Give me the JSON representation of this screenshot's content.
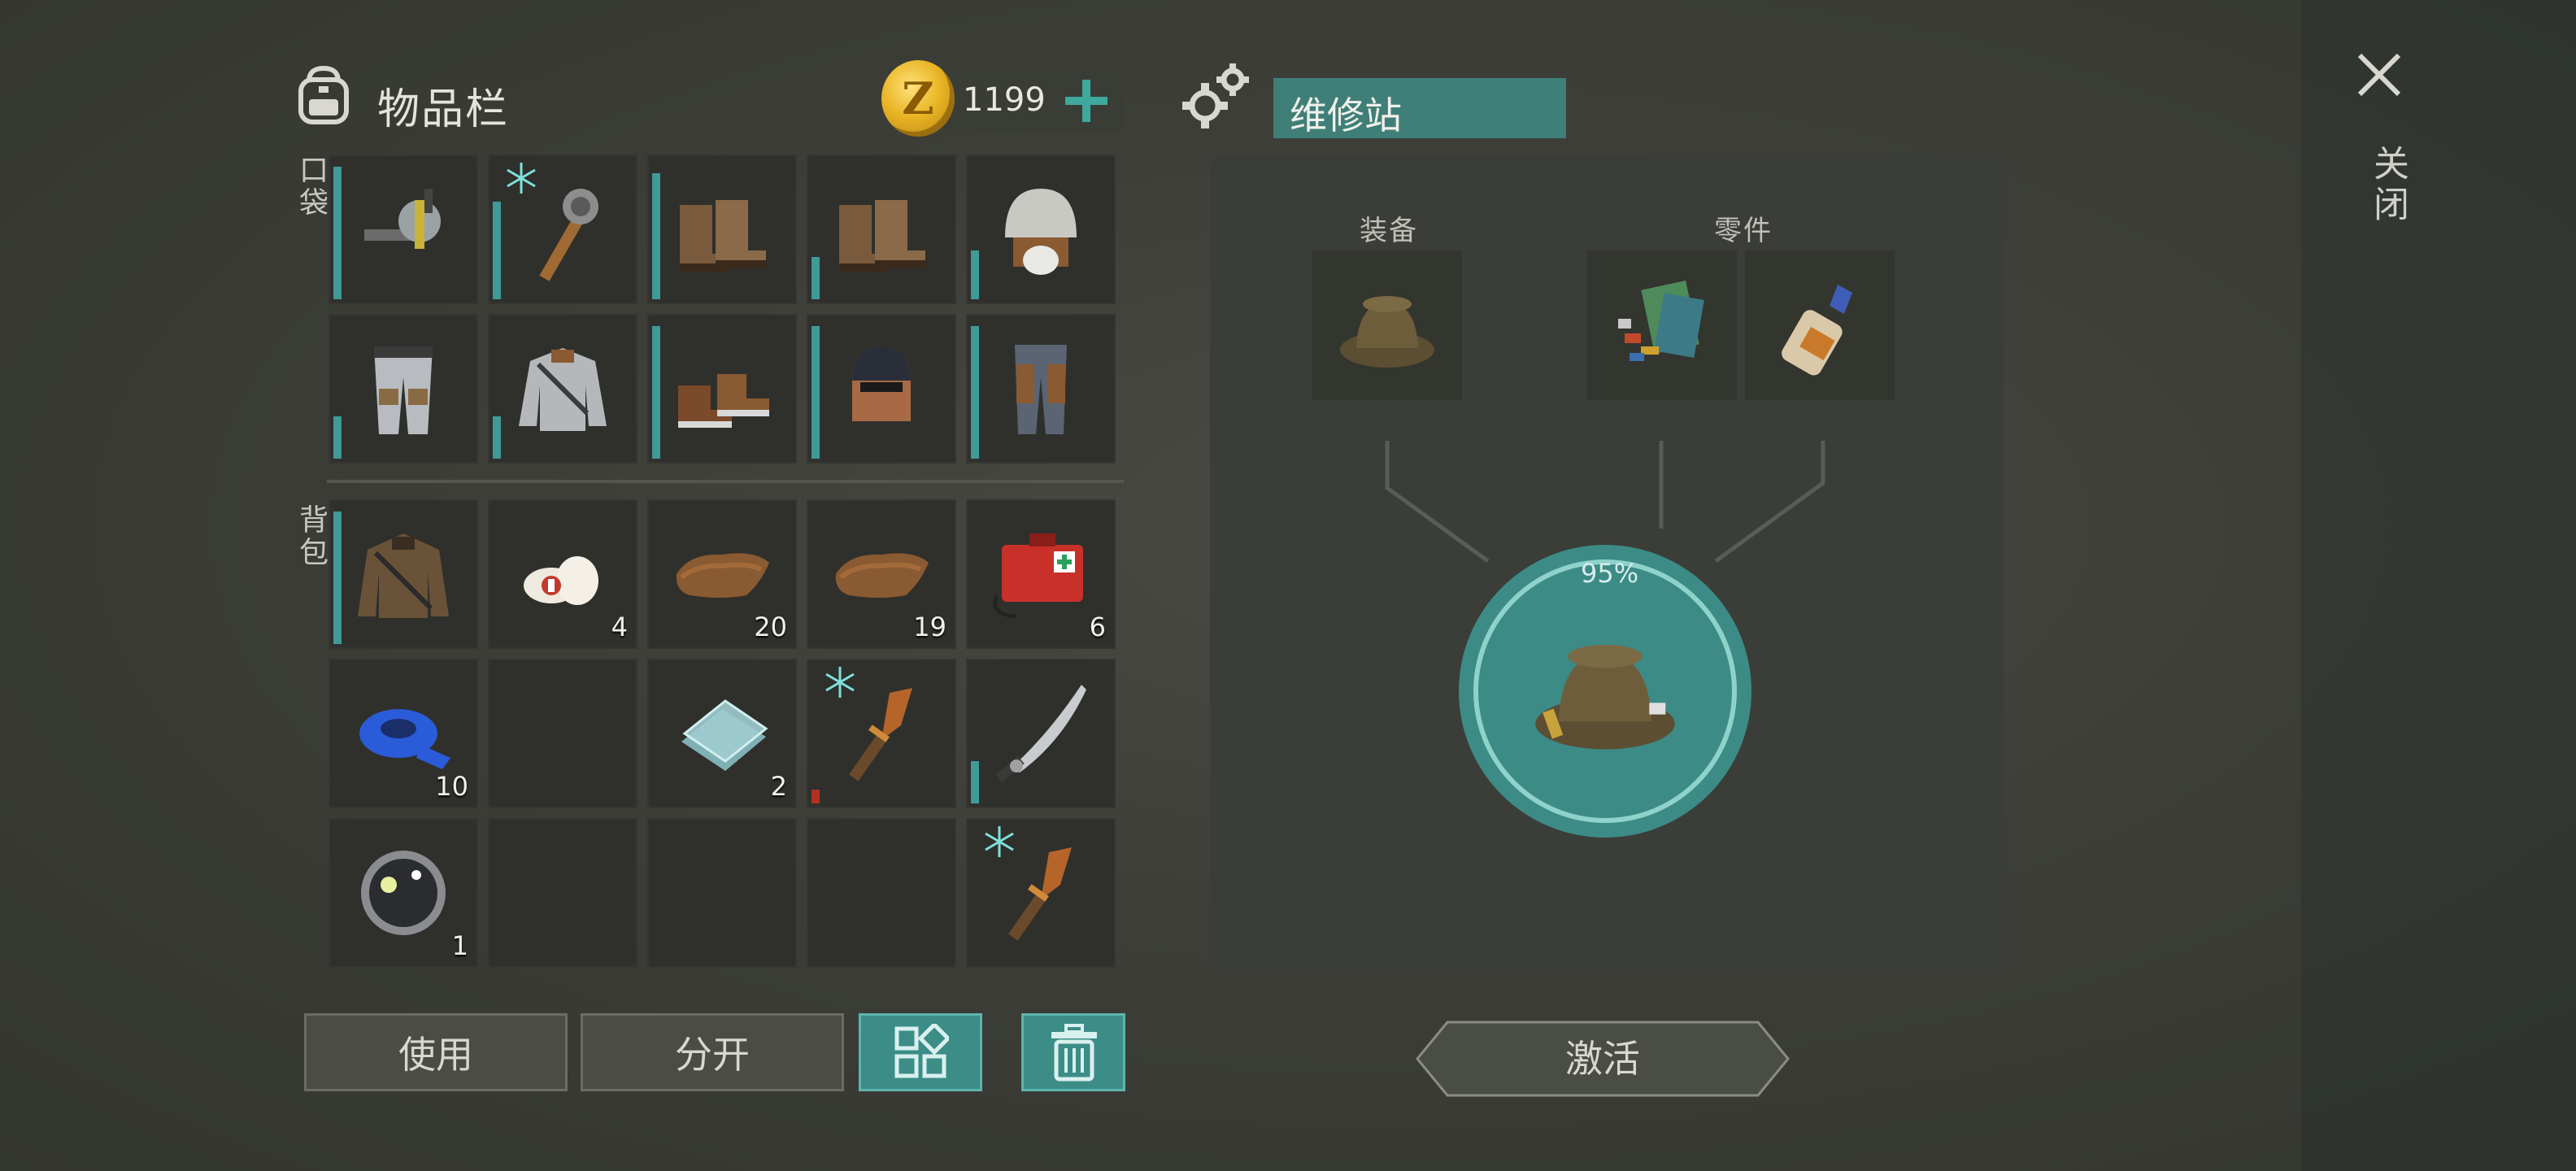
{
  "inventory": {
    "title": "物品栏",
    "coins": "1199"
  },
  "labels": {
    "pockets": "口袋",
    "backpack": "背包"
  },
  "pockets": [
    {
      "icon": "drill-icon",
      "count": "",
      "durability": 0.95,
      "frozen": false
    },
    {
      "icon": "spiked-club-icon",
      "count": "",
      "durability": 0.7,
      "frozen": true
    },
    {
      "icon": "boots-icon",
      "count": "",
      "durability": 0.9,
      "frozen": false
    },
    {
      "icon": "boots-icon",
      "count": "",
      "durability": 0.3,
      "frozen": false
    },
    {
      "icon": "fur-hat-icon",
      "count": "",
      "durability": 0.35,
      "frozen": false
    },
    {
      "icon": "armored-pants-icon",
      "count": "",
      "durability": 0.3,
      "frozen": false
    },
    {
      "icon": "armored-jacket-icon",
      "count": "",
      "durability": 0.3,
      "frozen": false
    },
    {
      "icon": "leather-shoes-icon",
      "count": "",
      "durability": 0.95,
      "frozen": false
    },
    {
      "icon": "welding-helmet-icon",
      "count": "",
      "durability": 0.95,
      "frozen": false
    },
    {
      "icon": "leather-pants-icon",
      "count": "",
      "durability": 0.95,
      "frozen": false
    }
  ],
  "backpack": [
    {
      "icon": "leather-jacket-icon",
      "count": "",
      "durability": 0.95,
      "frozen": false
    },
    {
      "icon": "bandage-icon",
      "count": "4",
      "durability": null,
      "frozen": false
    },
    {
      "icon": "leather-icon",
      "count": "20",
      "durability": null,
      "frozen": false
    },
    {
      "icon": "leather-icon",
      "count": "19",
      "durability": null,
      "frozen": false
    },
    {
      "icon": "first-aid-kit-icon",
      "count": "6",
      "durability": null,
      "frozen": false
    },
    {
      "icon": "blue-tape-icon",
      "count": "10",
      "durability": null,
      "frozen": false
    },
    {
      "icon": "empty",
      "count": "",
      "durability": null,
      "frozen": false
    },
    {
      "icon": "glass-sheets-icon",
      "count": "2",
      "durability": null,
      "frozen": false
    },
    {
      "icon": "knife-icon",
      "count": "",
      "durability": 0.1,
      "frozen": true,
      "low": true
    },
    {
      "icon": "machete-icon",
      "count": "",
      "durability": 0.3,
      "frozen": false
    },
    {
      "icon": "lens-icon",
      "count": "1",
      "durability": null,
      "frozen": false
    },
    {
      "icon": "empty",
      "count": "",
      "durability": null,
      "frozen": false
    },
    {
      "icon": "empty",
      "count": "",
      "durability": null,
      "frozen": false
    },
    {
      "icon": "empty",
      "count": "",
      "durability": null,
      "frozen": false
    },
    {
      "icon": "knife-icon",
      "count": "",
      "durability": null,
      "frozen": true
    }
  ],
  "buttons": {
    "use": "使用",
    "split": "分开"
  },
  "station": {
    "title": "维修站",
    "equipment_label": "装备",
    "parts_label": "零件",
    "equipment_icon": "bucket-hat-icon",
    "parts_icons": [
      "scrap-parts-icon",
      "glue-icon"
    ],
    "result_icon": "bucket-hat-icon",
    "progress": "95%",
    "activate": "激活"
  },
  "close": {
    "label": "关闭"
  },
  "colors": {
    "teal": "#3c8c87",
    "gold": "#e9b525",
    "durability": "#3f9a98",
    "durability_low": "#b23022"
  }
}
